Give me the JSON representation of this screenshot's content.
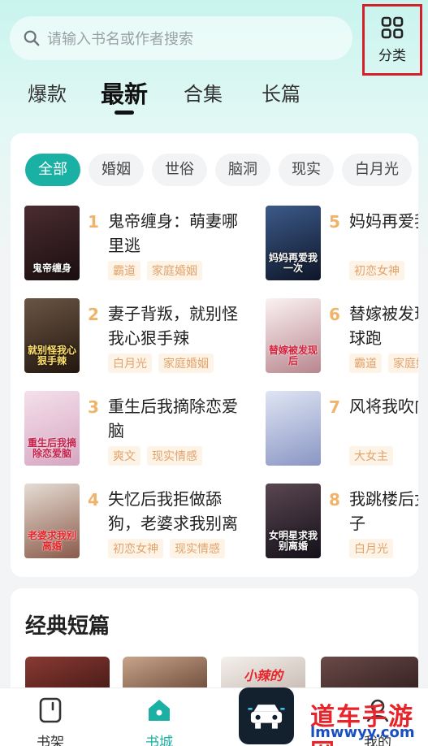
{
  "search": {
    "placeholder": "请输入书名或作者搜索"
  },
  "category_button": {
    "label": "分类"
  },
  "tabs": [
    {
      "label": "爆款"
    },
    {
      "label": "最新"
    },
    {
      "label": "合集"
    },
    {
      "label": "长篇"
    }
  ],
  "chips": [
    "全部",
    "婚姻",
    "世俗",
    "脑洞",
    "现实",
    "白月光"
  ],
  "books": [
    {
      "rank": "1",
      "title": "鬼帝缠身：萌妻哪里逃",
      "tags": [
        "霸道",
        "家庭婚姻"
      ],
      "cover_text": "鬼帝缠身",
      "cover_color": "#2a1a1e"
    },
    {
      "rank": "2",
      "title": "妻子背叛，就别怪我心狠手辣",
      "tags": [
        "白月光",
        "家庭婚姻"
      ],
      "cover_text": "就别怪我心狠手辣",
      "cover_color": "#3a2a22"
    },
    {
      "rank": "3",
      "title": "重生后我摘除恋爱脑",
      "tags": [
        "爽文",
        "现实情感"
      ],
      "cover_text": "重生后我摘除恋爱脑",
      "cover_color": "#e9c8d6"
    },
    {
      "rank": "4",
      "title": "失忆后我拒做舔狗，老婆求我别离婚",
      "tags": [
        "初恋女神",
        "现实情感"
      ],
      "cover_text": "老婆求我别离婚",
      "cover_color": "#d8d0c8"
    },
    {
      "rank": "5",
      "title": "妈妈再爱我一次",
      "tags": [
        "初恋女神"
      ],
      "cover_text": "妈妈再爱我一次",
      "cover_color": "#1d2b4a"
    },
    {
      "rank": "6",
      "title": "替嫁被发现后我带球跑",
      "tags": [
        "霸道",
        "家庭婚姻"
      ],
      "cover_text": "替嫁被发现后",
      "cover_color": "#f0e6e8"
    },
    {
      "rank": "7",
      "title": "风将我吹向你",
      "tags": [
        "大女主"
      ],
      "cover_text": "",
      "cover_color": "#b8c4e2"
    },
    {
      "rank": "8",
      "title": "我跳楼后女明星妻子",
      "tags": [
        "白月光"
      ],
      "cover_text": "女明星求我别离婚",
      "cover_color": "#2a2228"
    }
  ],
  "classic": {
    "title": "经典短篇",
    "cover_text_3": "小辣的"
  },
  "bottom_nav": [
    {
      "label": "书架"
    },
    {
      "label": "书城"
    },
    {
      "label": "我的"
    }
  ],
  "watermark": {
    "line1": "道车手游网",
    "line2": "lmwwyy.com"
  },
  "colors": {
    "accent": "#1bb0a4",
    "rank": "#efb46a",
    "tag_text": "#e2a36a",
    "highlight_box": "#d3202a"
  }
}
